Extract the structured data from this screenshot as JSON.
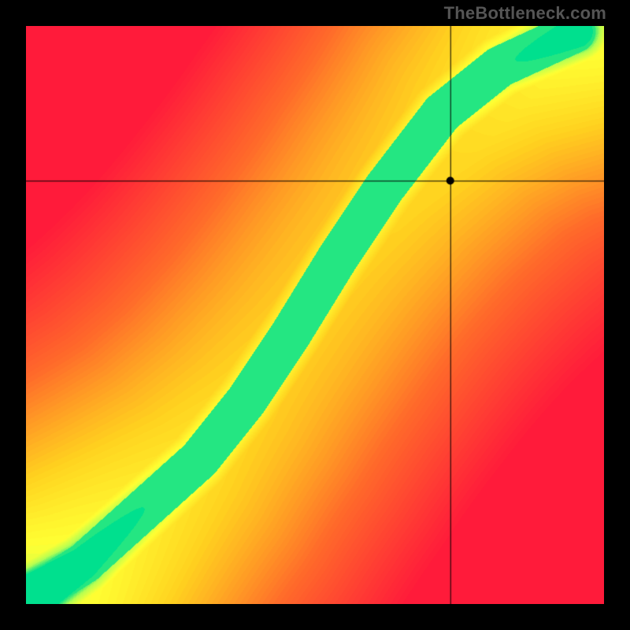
{
  "watermark": "TheBottleneck.com",
  "chart_data": {
    "type": "heatmap",
    "title": "",
    "xlabel": "",
    "ylabel": "",
    "xlim": [
      0,
      1
    ],
    "ylim": [
      0,
      1
    ],
    "stops": [
      {
        "t": 0.0,
        "color": "#ff1b3a"
      },
      {
        "t": 0.35,
        "color": "#ff6a2a"
      },
      {
        "t": 0.65,
        "color": "#ffd21f"
      },
      {
        "t": 0.82,
        "color": "#ffff33"
      },
      {
        "t": 0.92,
        "color": "#b7ff52"
      },
      {
        "t": 1.0,
        "color": "#00e08e"
      }
    ],
    "point": {
      "x": 0.735,
      "y": 0.732
    },
    "crosshair": {
      "x": 0.735,
      "y": 0.732
    },
    "ridge": {
      "points": [
        {
          "x": 0.02,
          "y": 0.02
        },
        {
          "x": 0.1,
          "y": 0.07
        },
        {
          "x": 0.2,
          "y": 0.16
        },
        {
          "x": 0.3,
          "y": 0.25
        },
        {
          "x": 0.38,
          "y": 0.35
        },
        {
          "x": 0.46,
          "y": 0.47
        },
        {
          "x": 0.54,
          "y": 0.6
        },
        {
          "x": 0.62,
          "y": 0.72
        },
        {
          "x": 0.72,
          "y": 0.85
        },
        {
          "x": 0.82,
          "y": 0.93
        },
        {
          "x": 0.95,
          "y": 0.99
        }
      ],
      "width": 0.065
    },
    "corner_bias": {
      "top_left": -0.55,
      "top_right": 0.45,
      "bottom_left": 0.7,
      "bottom_right": -0.55
    }
  }
}
